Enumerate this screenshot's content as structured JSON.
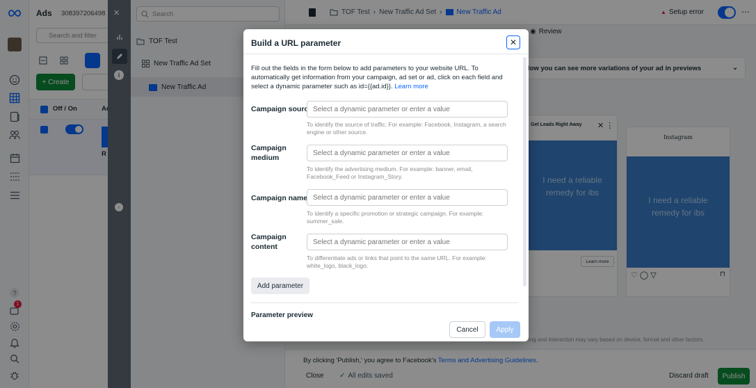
{
  "left_rail": {
    "logo": "meta-infinity-icon",
    "items": [
      "avatar",
      "emoji-icon",
      "grid-icon",
      "page-icon",
      "people-icon",
      "calendar-icon",
      "list-icon",
      "menu-icon"
    ],
    "bottom": [
      "help-icon",
      "notifications-icon",
      "settings-icon",
      "bell-icon",
      "search-icon",
      "bug-icon"
    ],
    "notification_count": "1"
  },
  "ads_panel": {
    "title": "Ads",
    "account_id": "308397206498",
    "search_filter": "Search and filter",
    "create_label": "+ Create",
    "col_off_on": "Off / On",
    "col_a": "Ad",
    "row_partial": "R"
  },
  "tree": {
    "search_placeholder": "Search",
    "items": [
      {
        "label": "TOF Test"
      },
      {
        "label": "New Traffic Ad Set"
      },
      {
        "label": "New Traffic Ad"
      }
    ]
  },
  "header": {
    "breadcrumb_1": "TOF Test",
    "breadcrumb_2": "New Traffic Ad Set",
    "breadcrumb_3": "New Traffic Ad",
    "setup_error": "Setup error",
    "review_tab": "Review"
  },
  "preview": {
    "banner_text": "low you can see more variations of your ad in previews",
    "ad_text": "I need a reliable remedy for ibs",
    "card1_title": "Get Leads Right Away",
    "card2_brand": "Instagram",
    "learn_more": "Learn more",
    "footnote": "ing and interaction may vary based on device, format and other factors."
  },
  "footer": {
    "terms_prefix": "By clicking 'Publish,' you agree to Facebook's ",
    "terms_link": "Terms and Advertising Guidelines",
    "terms_suffix": ".",
    "close": "Close",
    "saved": "All edits saved",
    "discard": "Discard draft",
    "publish": "Publish"
  },
  "modal": {
    "title": "Build a URL parameter",
    "intro": "Fill out the fields in the form below to add parameters to your website URL. To automatically get information from your campaign, ad set or ad, click on each field and select a dynamic parameter such as id={{ad.id}}.",
    "learn_more": "Learn more",
    "placeholder": "Select a dynamic parameter or enter a value",
    "fields": [
      {
        "label": "Campaign source",
        "help": "To identify the source of traffic. For example: Facebook, Instagram, a search engine or other source."
      },
      {
        "label": "Campaign medium",
        "help": "To identify the advertising medium. For example: banner, email, Facebook_Feed or Instagram_Story."
      },
      {
        "label": "Campaign name",
        "help": "To identify a specific promotion or strategic campaign. For example: summer_sale."
      },
      {
        "label": "Campaign content",
        "help": "To differentiate ads or links that point to the same URL. For example: white_logo, black_logo."
      }
    ],
    "add_parameter": "Add parameter",
    "preview_heading": "Parameter preview",
    "cancel": "Cancel",
    "apply": "Apply"
  }
}
